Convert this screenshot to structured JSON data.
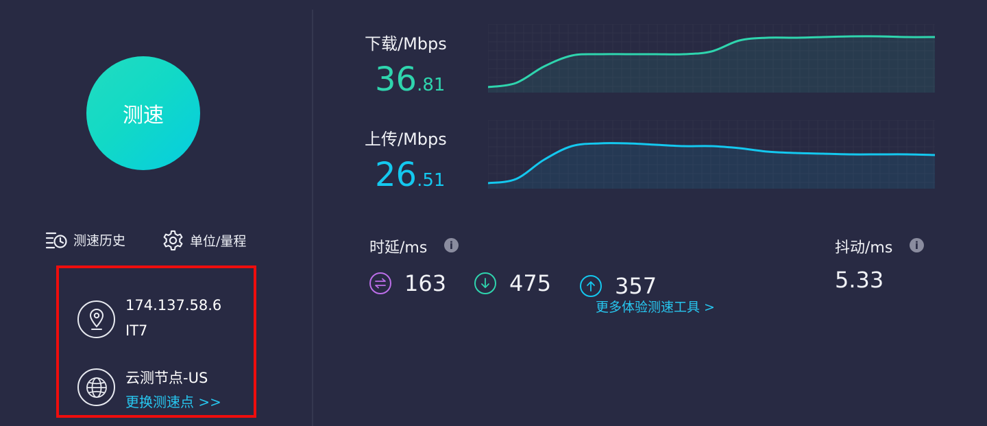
{
  "speedtest": {
    "button_label": "测速"
  },
  "tools": {
    "history_label": "测速历史",
    "units_label": "单位/量程"
  },
  "connection": {
    "ip": "174.137.58.6",
    "isp": "IT7",
    "node": "云测节点-US",
    "change_node_label": "更换测速点 >>"
  },
  "download": {
    "label": "下载/Mbps",
    "value_int": "36",
    "value_dec": ".81",
    "color": "#2fd5ae",
    "series": [
      8,
      14,
      38,
      54,
      56,
      56,
      56,
      56,
      60,
      76,
      80,
      80,
      81,
      82,
      82,
      81,
      81
    ]
  },
  "upload": {
    "label": "上传/Mbps",
    "value_int": "26",
    "value_dec": ".51",
    "color": "#14c8ef",
    "series": [
      8,
      14,
      42,
      62,
      66,
      66,
      64,
      62,
      62,
      59,
      54,
      52,
      51,
      50,
      50,
      50,
      49
    ]
  },
  "latency": {
    "label": "时延/ms",
    "idle": "163",
    "download": "475",
    "upload": "357",
    "idle_color": "#bc6ee9"
  },
  "jitter": {
    "label": "抖动/ms",
    "value": "5.33"
  },
  "more_tools_label": "更多体验测速工具 >",
  "accent_link_color": "#27c6ef",
  "highlight_border_color": "#ee0d0d"
}
